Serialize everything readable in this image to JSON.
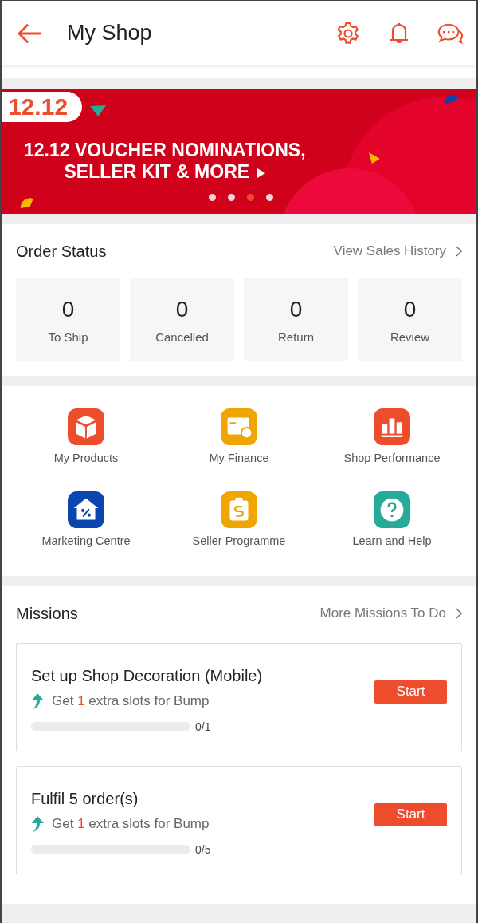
{
  "header": {
    "title": "My Shop"
  },
  "banner": {
    "badge": "12.12",
    "headline": "12.12 VOUCHER NOMINATIONS,",
    "subline": "SELLER KIT & MORE",
    "dots": [
      {
        "selected": false
      },
      {
        "selected": false
      },
      {
        "selected": true
      },
      {
        "selected": false
      }
    ]
  },
  "order_status": {
    "title": "Order Status",
    "link": "View Sales History",
    "tiles": [
      {
        "count": "0",
        "label": "To Ship"
      },
      {
        "count": "0",
        "label": "Cancelled"
      },
      {
        "count": "0",
        "label": "Return"
      },
      {
        "count": "0",
        "label": "Review"
      }
    ]
  },
  "shortcuts": [
    {
      "kind": "box",
      "label": "My Products",
      "color": "#ee4d2d"
    },
    {
      "kind": "wallet",
      "label": "My Finance",
      "color": "#f0a500"
    },
    {
      "kind": "chart",
      "label": "Shop Performance",
      "color": "#ee4d2d"
    },
    {
      "kind": "house",
      "label": "Marketing Centre",
      "color": "#0b46ae"
    },
    {
      "kind": "clipboard",
      "label": "Seller Programme",
      "color": "#f0a500"
    },
    {
      "kind": "help",
      "label": "Learn and Help",
      "color": "#26aa99"
    }
  ],
  "missions": {
    "title": "Missions",
    "link": "More Missions To Do",
    "items": [
      {
        "title": "Set up Shop Decoration (Mobile)",
        "reward_before": "Get",
        "reward_count": "1",
        "reward_after": "extra slots for Bump",
        "button": "Start",
        "level": 0,
        "progress": "0/1"
      },
      {
        "title": "Fulfil 5 order(s)",
        "reward_before": "Get",
        "reward_count": "1",
        "reward_after": "extra slots for Bump",
        "button": "Start",
        "level": 0,
        "progress": "0/5"
      }
    ]
  }
}
